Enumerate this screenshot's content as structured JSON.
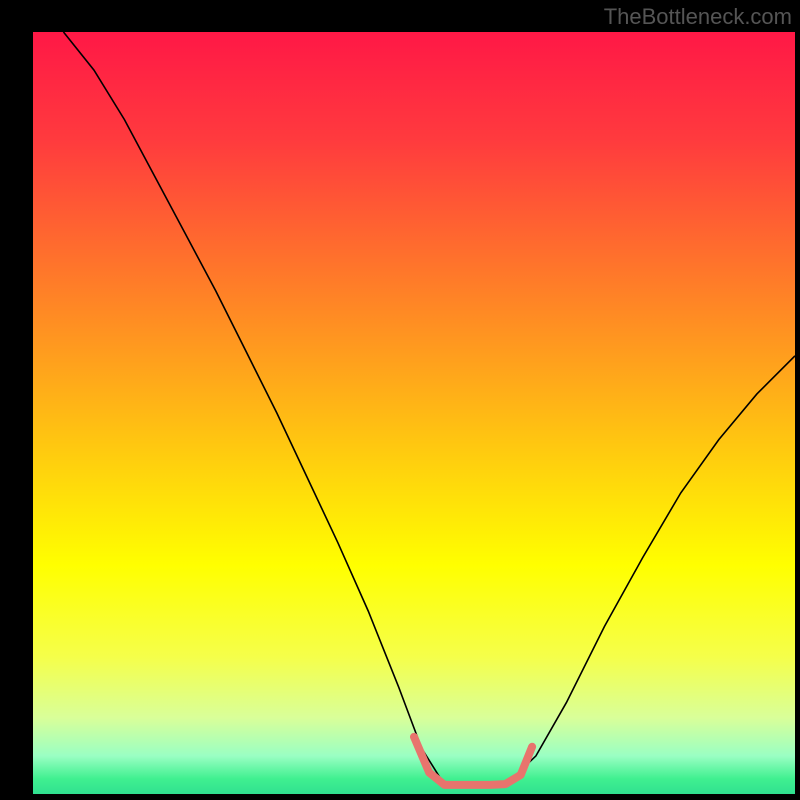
{
  "watermark": "TheBottleneck.com",
  "chart_data": {
    "type": "line",
    "title": "",
    "xlabel": "",
    "ylabel": "",
    "xlim": [
      0,
      100
    ],
    "ylim": [
      0,
      100
    ],
    "background_gradient_stops": [
      {
        "pct": 0.0,
        "color": "#ff1846"
      },
      {
        "pct": 0.14,
        "color": "#ff3a3e"
      },
      {
        "pct": 0.28,
        "color": "#ff6b2e"
      },
      {
        "pct": 0.42,
        "color": "#ff9c1e"
      },
      {
        "pct": 0.56,
        "color": "#ffce0e"
      },
      {
        "pct": 0.7,
        "color": "#ffff00"
      },
      {
        "pct": 0.82,
        "color": "#f5ff4a"
      },
      {
        "pct": 0.9,
        "color": "#d9ff99"
      },
      {
        "pct": 0.95,
        "color": "#9affc3"
      },
      {
        "pct": 0.98,
        "color": "#40f090"
      },
      {
        "pct": 1.0,
        "color": "#30e090"
      }
    ],
    "series": [
      {
        "name": "curve",
        "stroke": "#000000",
        "stroke_width": 1.6,
        "x": [
          4,
          8,
          12,
          16,
          20,
          24,
          28,
          32,
          36,
          40,
          44,
          48,
          51,
          54,
          58,
          62,
          66,
          70,
          75,
          80,
          85,
          90,
          95,
          100
        ],
        "y": [
          100,
          95,
          88.5,
          81,
          73.5,
          66,
          58,
          50,
          41.5,
          33,
          24,
          14,
          6,
          1.2,
          1.2,
          1.2,
          5,
          12,
          22,
          31,
          39.5,
          46.5,
          52.5,
          57.5
        ]
      },
      {
        "name": "highlight-band",
        "stroke": "#e8746d",
        "stroke_width": 8,
        "linecap": "round",
        "x": [
          50,
          52,
          54,
          56,
          58,
          60,
          62,
          64,
          65.5
        ],
        "y": [
          7.5,
          2.8,
          1.2,
          1.2,
          1.2,
          1.2,
          1.3,
          2.5,
          6.2
        ]
      }
    ]
  }
}
